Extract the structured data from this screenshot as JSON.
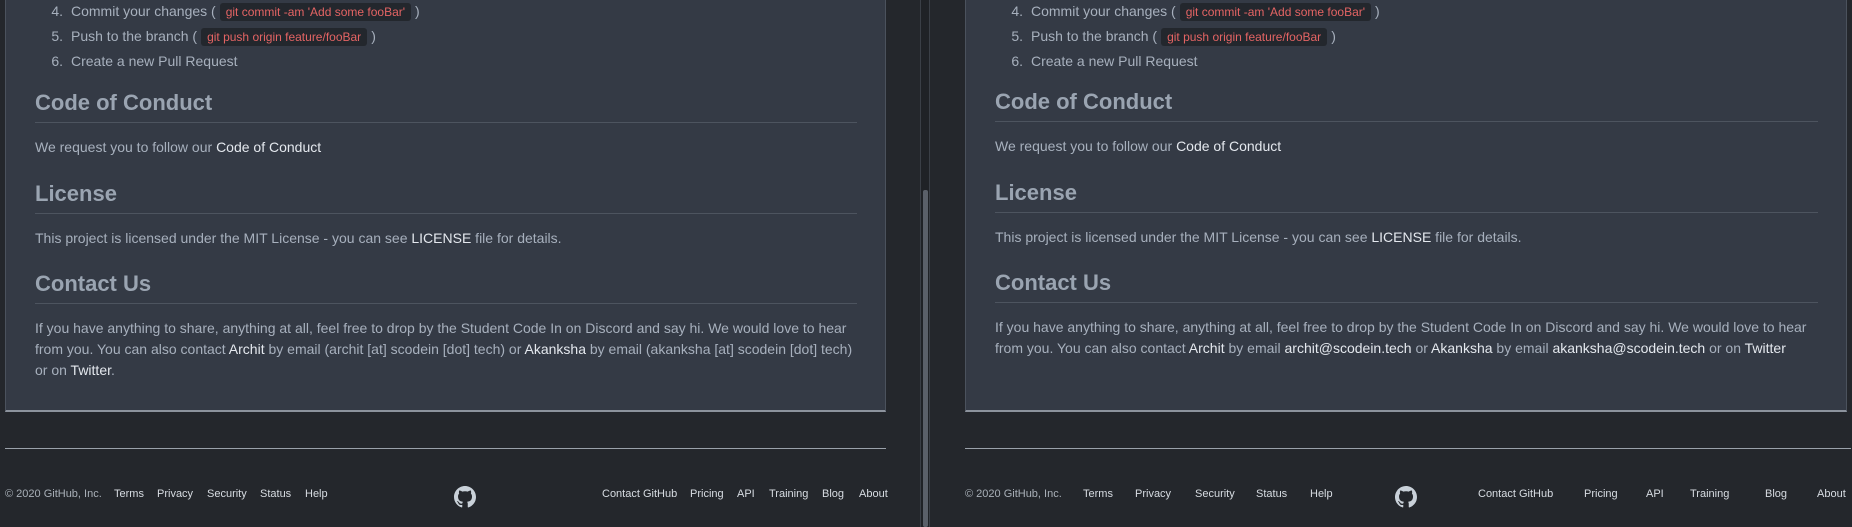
{
  "steps": [
    {
      "num": "4.",
      "before": "Commit your changes (",
      "code": "git commit -am 'Add some fooBar'",
      "after": ")"
    },
    {
      "num": "5.",
      "before": "Push to the branch (",
      "code": "git push origin feature/fooBar",
      "after": ")"
    },
    {
      "num": "6.",
      "before": "Create a new Pull Request",
      "code": "",
      "after": ""
    }
  ],
  "conduct": {
    "heading": "Code of Conduct",
    "text": "We request you to follow our ",
    "link": "Code of Conduct"
  },
  "license": {
    "heading": "License",
    "before": "This project is licensed under the MIT License - you can see ",
    "link": "LICENSE",
    "after": " file for details."
  },
  "contact": {
    "heading": "Contact Us",
    "left": {
      "intro": "If you have anything to share, anything at all, feel free to drop by the Student Code In on Discord and say hi. We would love to hear from you. You can also contact ",
      "archit": "Archit",
      "mid1": " by email (archit [at] scodein [dot] tech) or ",
      "akanksha": "Akanksha",
      "mid2": " by email (akanksha [at] scodein [dot] tech) or on ",
      "twitter": "Twitter",
      "end": "."
    },
    "right": {
      "intro": "If you have anything to share, anything at all, feel free to drop by the Student Code In on Discord and say hi. We would love to hear from you. You can also contact ",
      "archit": "Archit",
      "mid1": " by email ",
      "archit_email": "archit@scodein.tech",
      "mid2": " or ",
      "akanksha": "Akanksha",
      "mid3": " by email ",
      "akanksha_email": "akanksha@scodein.tech",
      "mid4": " or on ",
      "twitter": "Twitter"
    }
  },
  "footer": {
    "copyright": "© 2020 GitHub, Inc.",
    "left_links": [
      "Terms",
      "Privacy",
      "Security",
      "Status",
      "Help"
    ],
    "right_links": [
      "Contact GitHub",
      "Pricing",
      "API",
      "Training",
      "Blog",
      "About"
    ],
    "logo_icon": "github-octocat-icon"
  }
}
